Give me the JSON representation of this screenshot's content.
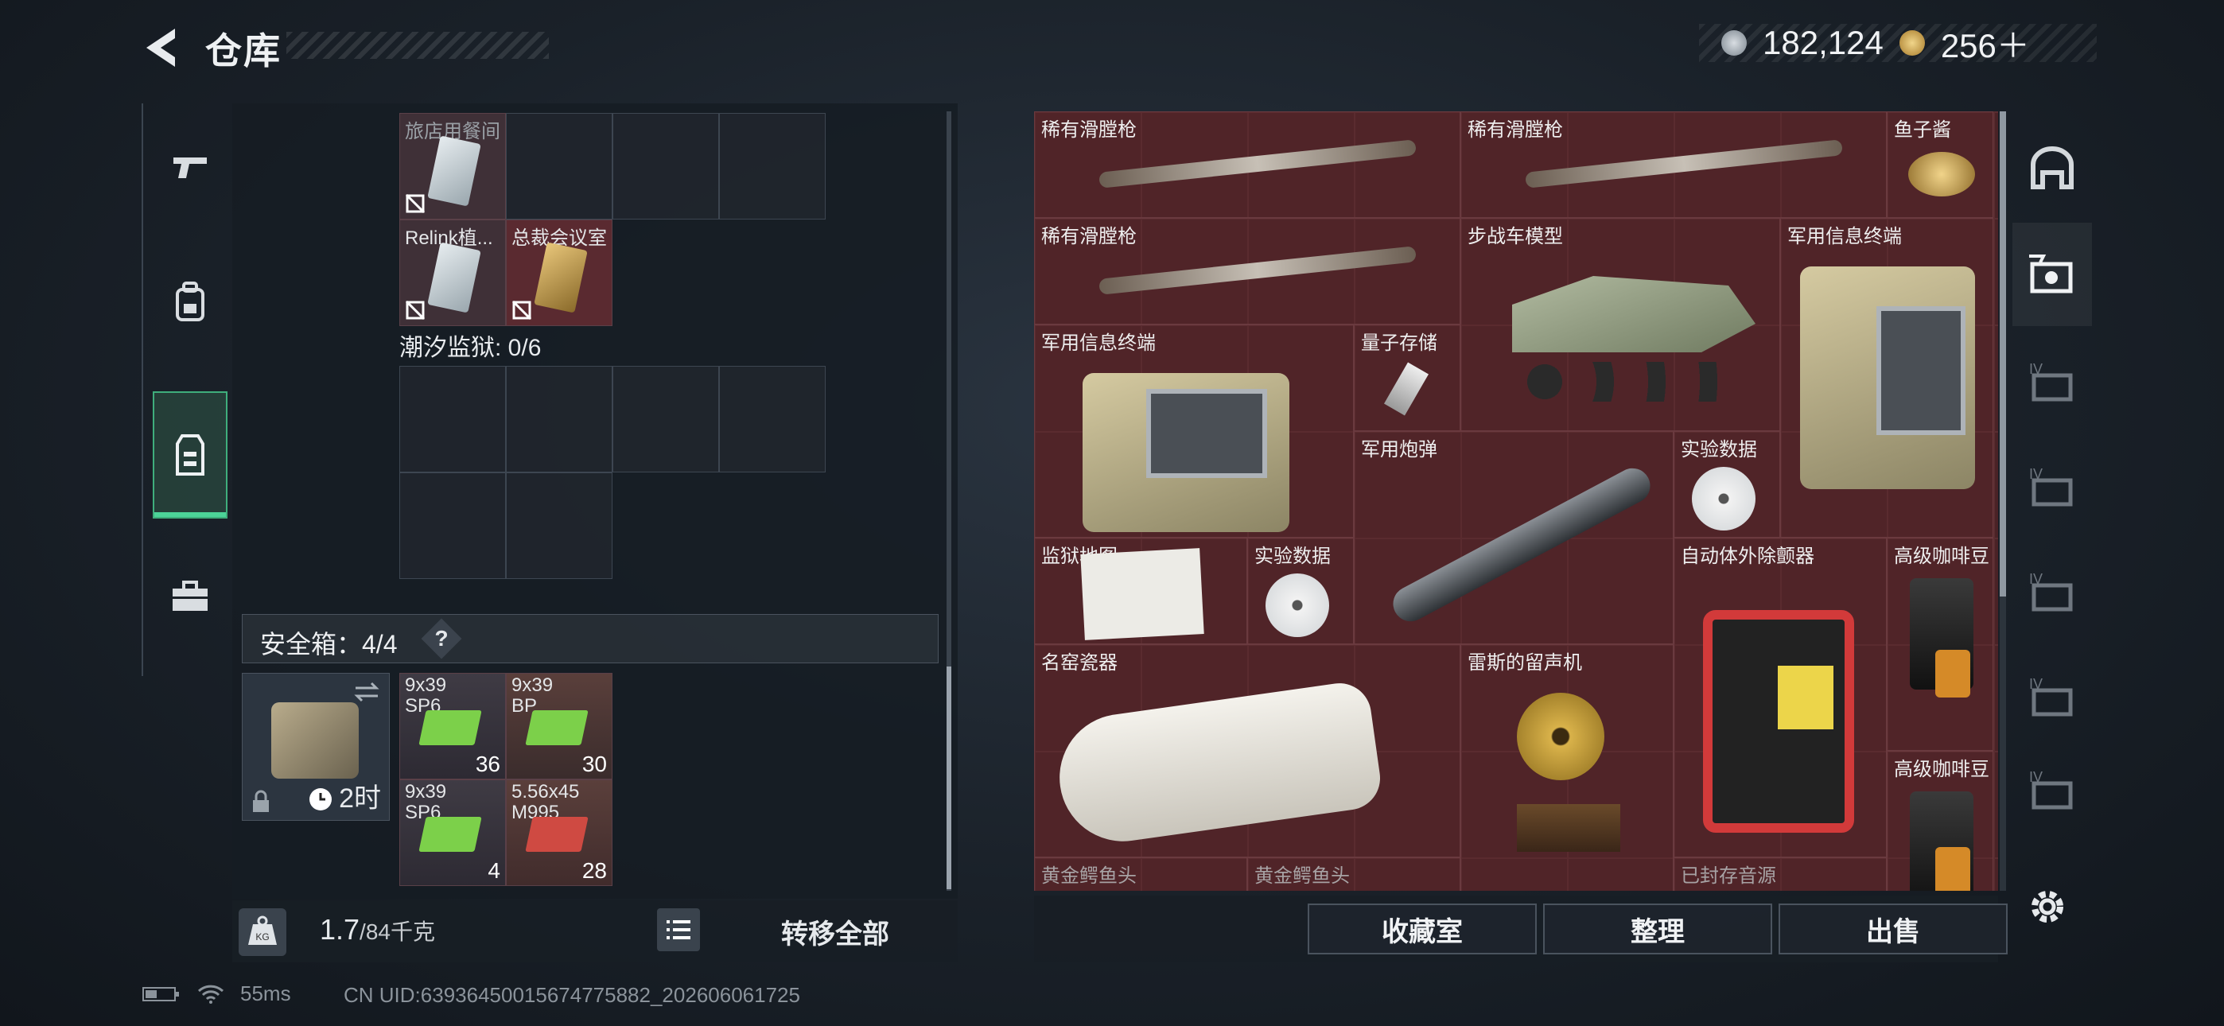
{
  "header": {
    "title": "仓库"
  },
  "currency": [
    {
      "icon": "silver-coin-icon",
      "value": "182,124"
    },
    {
      "icon": "gold-coin-icon",
      "value": "256＋"
    }
  ],
  "left_tabs": [
    {
      "icon": "pistol-icon",
      "active": false
    },
    {
      "icon": "backpack-icon",
      "active": false
    },
    {
      "icon": "vest-icon",
      "active": true
    },
    {
      "icon": "toolbox-icon",
      "active": false
    }
  ],
  "keys": {
    "items": [
      {
        "name": "旅店用餐间",
        "icon": "keycard-icon"
      },
      {
        "name": "Relink植...",
        "icon": "keycard-icon"
      },
      {
        "name": "总裁会议室",
        "icon": "keycard-icon"
      }
    ]
  },
  "prison": {
    "label": "潮汐监狱: 0/6"
  },
  "safe_box": {
    "label": "安全箱：4/4",
    "help": "?",
    "timer": "2时",
    "ammo": [
      {
        "name": "9x39 SP6",
        "qty": "36"
      },
      {
        "name": "9x39 BP",
        "qty": "30"
      },
      {
        "name": "9x39 SP6",
        "qty": "4"
      },
      {
        "name": "5.56x45 M995",
        "qty": "28"
      }
    ]
  },
  "weight": {
    "current": "1.7",
    "max": "/84千克"
  },
  "buttons": {
    "transfer_all": "转移全部",
    "collection": "收藏室",
    "sort": "整理",
    "sell": "出售"
  },
  "stash_items": [
    {
      "name": "稀有滑膛枪"
    },
    {
      "name": "稀有滑膛枪"
    },
    {
      "name": "鱼子酱"
    },
    {
      "name": "稀有滑膛枪"
    },
    {
      "name": "步战车模型"
    },
    {
      "name": "军用信息终端"
    },
    {
      "name": "军用信息终端"
    },
    {
      "name": "量子存储"
    },
    {
      "name": "军用炮弹"
    },
    {
      "name": "实验数据"
    },
    {
      "name": "监狱地图"
    },
    {
      "name": "实验数据"
    },
    {
      "name": "自动体外除颤器"
    },
    {
      "name": "高级咖啡豆"
    },
    {
      "name": "名窑瓷器"
    },
    {
      "name": "雷斯的留声机"
    },
    {
      "name": "高级咖啡豆"
    },
    {
      "name": "黄金鳄鱼头"
    },
    {
      "name": "黄金鳄鱼头"
    },
    {
      "name": "已封存音源"
    }
  ],
  "right_tabs": [
    {
      "icon": "stash-arch-icon"
    },
    {
      "icon": "collection-icon"
    },
    {
      "icon": "level-iv-icon",
      "label": "IV"
    },
    {
      "icon": "level-iv-icon",
      "label": "IV"
    },
    {
      "icon": "level-iv-icon",
      "label": "IV"
    },
    {
      "icon": "level-iv-icon",
      "label": "IV"
    },
    {
      "icon": "level-iv-icon",
      "label": "IV"
    }
  ],
  "status": {
    "ping": "55ms",
    "uid": "CN UID:6393645001567477​5882_202606061725"
  },
  "colors": {
    "accent": "#4cd398",
    "stash_bg": "#4a2226",
    "panel": "#161c23"
  }
}
